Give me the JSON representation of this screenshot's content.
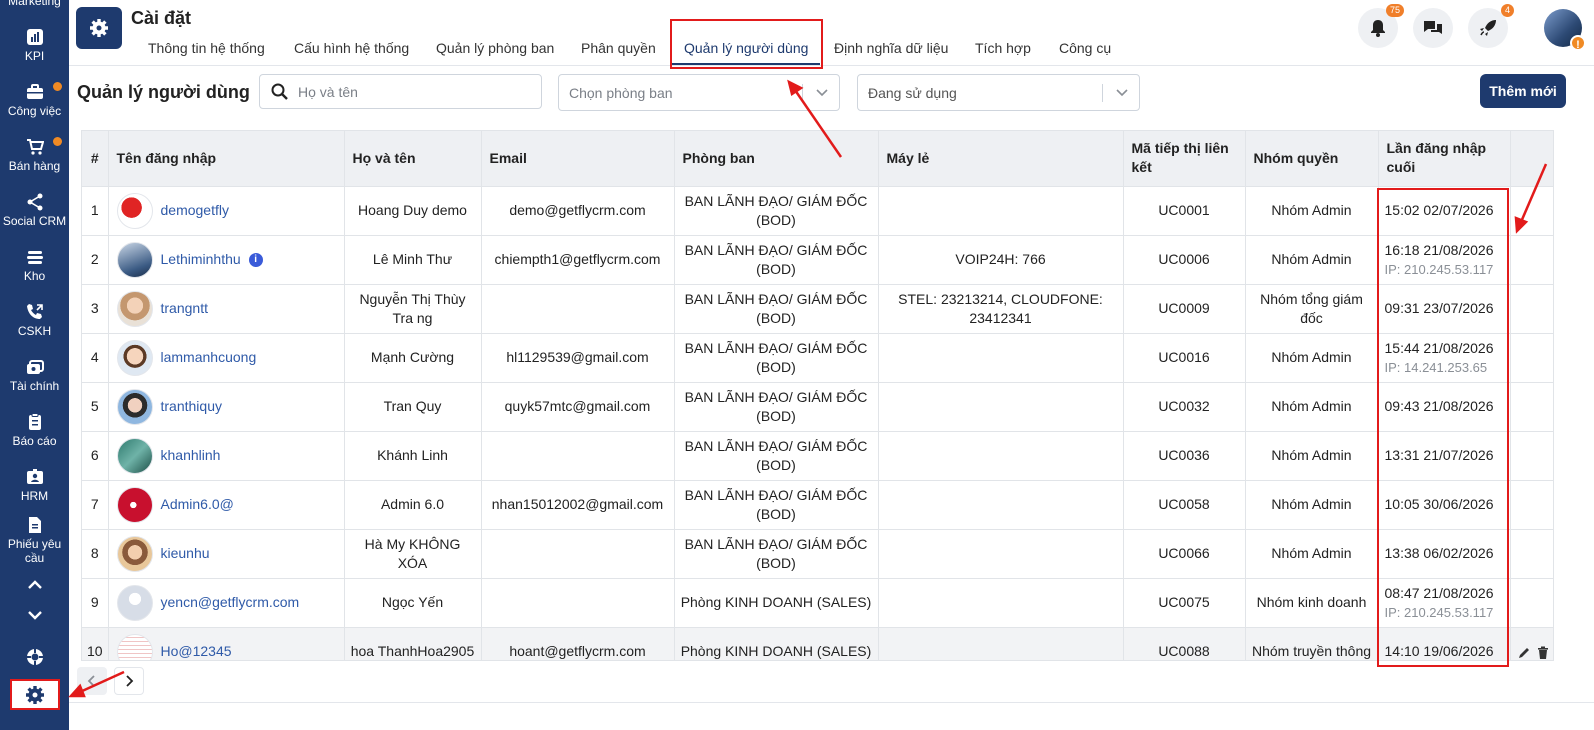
{
  "sidebar": {
    "items": [
      {
        "label": "Marketing",
        "icon": "megaphone-icon"
      },
      {
        "label": "KPI",
        "icon": "bar-chart-icon"
      },
      {
        "label": "Công việc",
        "icon": "briefcase-icon"
      },
      {
        "label": "Bán hàng",
        "icon": "cart-icon"
      },
      {
        "label": "Social CRM",
        "icon": "share-icon"
      },
      {
        "label": "Kho",
        "icon": "warehouse-icon"
      },
      {
        "label": "CSKH",
        "icon": "phone-icon"
      },
      {
        "label": "Tài chính",
        "icon": "money-icon"
      },
      {
        "label": "Báo cáo",
        "icon": "clipboard-icon"
      },
      {
        "label": "HRM",
        "icon": "id-card-icon"
      },
      {
        "label": "Phiếu yêu cầu",
        "icon": "document-icon"
      }
    ]
  },
  "header": {
    "title": "Cài đặt",
    "tabs": [
      {
        "label": "Thông tin hệ thống"
      },
      {
        "label": "Cấu hình hệ thống"
      },
      {
        "label": "Quản lý phòng ban"
      },
      {
        "label": "Phân quyền"
      },
      {
        "label": "Quản lý người dùng"
      },
      {
        "label": "Định nghĩa dữ liệu"
      },
      {
        "label": "Tích hợp"
      },
      {
        "label": "Công cụ"
      }
    ],
    "notifications_count": "75",
    "rocket_count": "4",
    "warning_mark": "!"
  },
  "toolbar": {
    "title": "Quản lý người dùng",
    "search_placeholder": "Họ và tên",
    "department_placeholder": "Chọn phòng ban",
    "status_value": "Đang sử dụng",
    "add_label": "Thêm mới"
  },
  "table": {
    "columns": [
      "#",
      "Tên đăng nhập",
      "Họ và tên",
      "Email",
      "Phòng ban",
      "Máy lẻ",
      "Mã tiếp thị liên kết",
      "Nhóm quyền",
      "Lần đăng nhập cuối"
    ],
    "rows": [
      {
        "no": "1",
        "username": "demogetfly",
        "fullname": "Hoang Duy demo",
        "email": "demo@getflycrm.com",
        "dept": "BAN LÃNH ĐẠO/ GIÁM ĐỐC (BOD)",
        "ext": "",
        "code": "UC0001",
        "group": "Nhóm Admin",
        "login": "15:02 02/07/2026",
        "ip": ""
      },
      {
        "no": "2",
        "username": "Lethiminhthu",
        "fullname": "Lê Minh Thư",
        "email": "chiempth1@getflycrm.com",
        "dept": "BAN LÃNH ĐẠO/ GIÁM ĐỐC (BOD)",
        "ext": "VOIP24H: 766",
        "code": "UC0006",
        "group": "Nhóm Admin",
        "login": "16:18 21/08/2026",
        "ip": "IP: 210.245.53.117"
      },
      {
        "no": "3",
        "username": "trangntt",
        "fullname": "Nguyễn Thị Thùy Tra ng",
        "email": "",
        "dept": "BAN LÃNH ĐẠO/ GIÁM ĐỐC (BOD)",
        "ext": "STEL: 23213214, CLOUDFONE: 23412341",
        "code": "UC0009",
        "group": "Nhóm tổng giám đốc",
        "login": "09:31 23/07/2026",
        "ip": ""
      },
      {
        "no": "4",
        "username": "lammanhcuong",
        "fullname": "Mạnh Cường",
        "email": "hl1129539@gmail.com",
        "dept": "BAN LÃNH ĐẠO/ GIÁM ĐỐC (BOD)",
        "ext": "",
        "code": "UC0016",
        "group": "Nhóm Admin",
        "login": "15:44 21/08/2026",
        "ip": "IP: 14.241.253.65"
      },
      {
        "no": "5",
        "username": "tranthiquy",
        "fullname": "Tran Quy",
        "email": "quyk57mtc@gmail.com",
        "dept": "BAN LÃNH ĐẠO/ GIÁM ĐỐC (BOD)",
        "ext": "",
        "code": "UC0032",
        "group": "Nhóm Admin",
        "login": "09:43 21/08/2026",
        "ip": ""
      },
      {
        "no": "6",
        "username": "khanhlinh",
        "fullname": "Khánh Linh",
        "email": "",
        "dept": "BAN LÃNH ĐẠO/ GIÁM ĐỐC (BOD)",
        "ext": "",
        "code": "UC0036",
        "group": "Nhóm Admin",
        "login": "13:31 21/07/2026",
        "ip": ""
      },
      {
        "no": "7",
        "username": "Admin6.0@",
        "fullname": "Admin 6.0",
        "email": "nhan15012002@gmail.com",
        "dept": "BAN LÃNH ĐẠO/ GIÁM ĐỐC (BOD)",
        "ext": "",
        "code": "UC0058",
        "group": "Nhóm Admin",
        "login": "10:05 30/06/2026",
        "ip": ""
      },
      {
        "no": "8",
        "username": "kieunhu",
        "fullname": "Hà My KHÔNG XÓA",
        "email": "",
        "dept": "BAN LÃNH ĐẠO/ GIÁM ĐỐC (BOD)",
        "ext": "",
        "code": "UC0066",
        "group": "Nhóm Admin",
        "login": "13:38 06/02/2026",
        "ip": ""
      },
      {
        "no": "9",
        "username": "yencn@getflycrm.com",
        "fullname": "Ngọc Yến",
        "email": "",
        "dept": "Phòng KINH DOANH (SALES)",
        "ext": "",
        "code": "UC0075",
        "group": "Nhóm kinh doanh",
        "login": "08:47 21/08/2026",
        "ip": "IP: 210.245.53.117"
      },
      {
        "no": "10",
        "username": "Ho@12345",
        "fullname": "hoa ThanhHoa2905",
        "email": "hoant@getflycrm.com",
        "dept": "Phòng KINH DOANH (SALES)",
        "ext": "",
        "code": "UC0088",
        "group": "Nhóm truyền thông",
        "login": "14:10 19/06/2026",
        "ip": ""
      }
    ]
  },
  "colors": {
    "primary": "#1e3a6e",
    "link": "#2f5aa8",
    "highlight": "#e21b1b",
    "badge": "#f07f2a"
  }
}
